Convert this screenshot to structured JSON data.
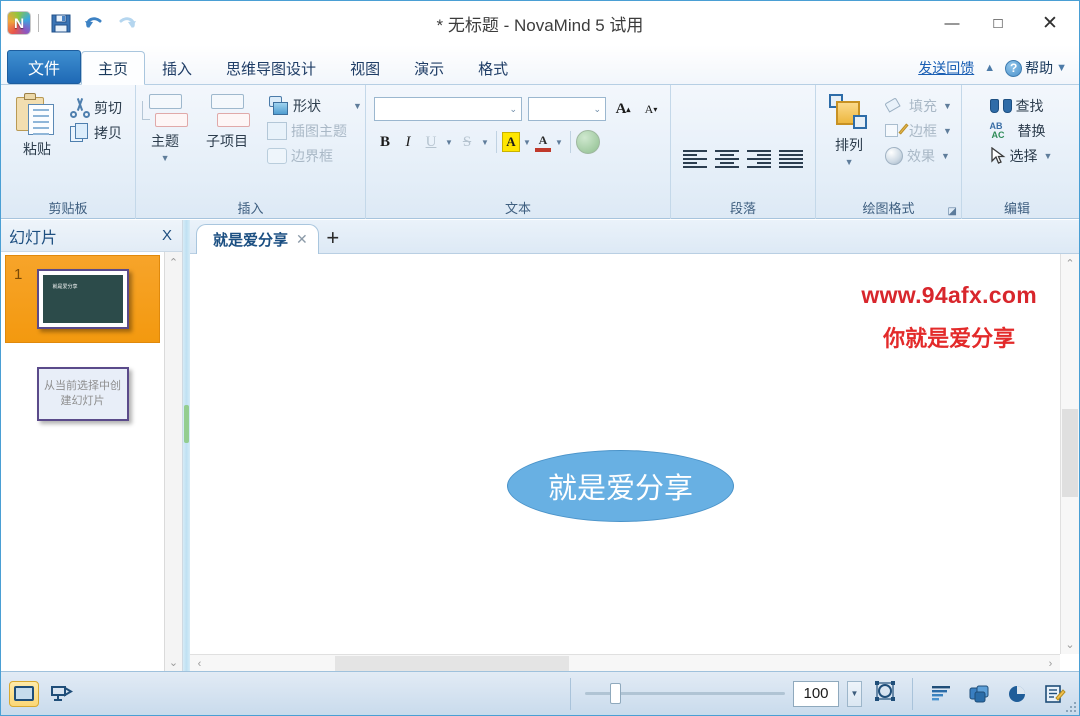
{
  "window": {
    "title": "* 无标题 - NovaMind 5 试用",
    "app_logo": "novamind-logo",
    "minimize": "—",
    "maximize": "□",
    "close": "✕"
  },
  "quick_access": {
    "save": "save-icon",
    "undo": "undo-icon",
    "redo": "redo-icon"
  },
  "tabs": [
    {
      "label": "文件",
      "kind": "file"
    },
    {
      "label": "主页",
      "kind": "active"
    },
    {
      "label": "插入",
      "kind": "normal"
    },
    {
      "label": "思维导图设计",
      "kind": "normal"
    },
    {
      "label": "视图",
      "kind": "normal"
    },
    {
      "label": "演示",
      "kind": "normal"
    },
    {
      "label": "格式",
      "kind": "normal"
    }
  ],
  "tabstrip_right": {
    "feedback": "发送回馈",
    "collapse": "▲",
    "help": "帮助",
    "help_glyph": "?",
    "help_caret": "▼"
  },
  "ribbon": {
    "clipboard": {
      "label": "剪贴板",
      "paste": "粘贴",
      "cut": "剪切",
      "copy": "拷贝"
    },
    "insert": {
      "label": "插入",
      "topic": "主题",
      "subtopic": "子项目",
      "shape": "形状",
      "illustration": "插图主题",
      "boundary": "边界框",
      "caret": "▼"
    },
    "text": {
      "label": "文本",
      "font_name": "",
      "font_name_placeholder": "",
      "font_size": "",
      "font_size_placeholder": "",
      "grow_font": "A",
      "shrink_font": "A",
      "bold": "B",
      "italic": "I",
      "underline": "U",
      "strikethrough": "S",
      "highlight": "A",
      "font_color": "A",
      "caret": "▼"
    },
    "paragraph": {
      "label": "段落",
      "align_left": "align-left",
      "align_center": "align-center",
      "align_right": "align-right",
      "align_justify": "align-justify"
    },
    "drawing": {
      "label": "绘图格式",
      "arrange": "排列",
      "fill": "填充",
      "border": "边框",
      "effect": "效果",
      "caret": "▼",
      "launcher": "◪"
    },
    "editing": {
      "label": "编辑",
      "find": "查找",
      "replace": "替换",
      "select": "选择",
      "caret": "▼"
    }
  },
  "sidebar": {
    "title": "幻灯片",
    "close": "X",
    "scroll_up": "⌃",
    "scroll_down": "⌄",
    "slides": [
      {
        "number": "1",
        "thumb_text": "就是爱分享"
      }
    ],
    "new_slide_button": "从当前选择中创建幻灯片"
  },
  "doctabs": {
    "tabs": [
      {
        "label": "就是爱分享",
        "close": "✕"
      }
    ],
    "new_tab": "+"
  },
  "canvas": {
    "watermark_line1": "www.94afx.com",
    "watermark_line2": "你就是爱分享",
    "watermark_color": "#d8262c",
    "nodes": [
      {
        "text": "就是爱分享",
        "fill": "#68b0e3",
        "text_color": "#ffffff"
      }
    ],
    "vscroll_up": "⌃",
    "vscroll_down": "⌄",
    "hscroll_left": "‹",
    "hscroll_right": "›"
  },
  "statusbar": {
    "view_normal": "normal-view-icon",
    "view_presentation": "presentation-view-icon",
    "zoom_value": "100",
    "zoom_caret": "▼",
    "fit_button": "fit-to-window-icon",
    "right_icons": [
      "outline-icon",
      "layers-icon",
      "chart-icon",
      "notes-icon"
    ]
  }
}
